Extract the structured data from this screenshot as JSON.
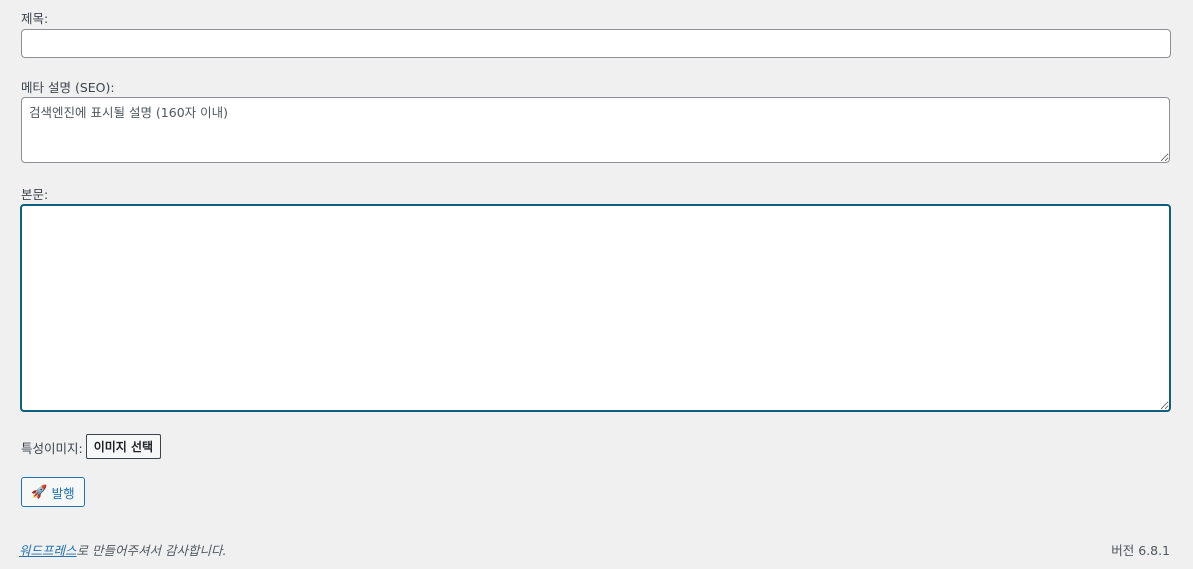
{
  "form": {
    "title_label": "제목:",
    "title_value": "",
    "meta_label": "메타 설명 (SEO):",
    "meta_placeholder": "검색엔진에 표시될 설명 (160자 이내)",
    "body_label": "본문:",
    "body_value": "",
    "featured_image_label": "특성이미지:",
    "choose_image_button": "이미지 선택",
    "publish_button": "발행",
    "publish_icon": "rocket-icon"
  },
  "footer": {
    "thanks_link": "워드프레스",
    "thanks_text": "로 만들어주셔서 감사합니다.",
    "version": "버전 6.8.1"
  },
  "colors": {
    "background": "#f0f0f1",
    "accent": "#2271b1",
    "focus_border": "#0d5f7a"
  }
}
